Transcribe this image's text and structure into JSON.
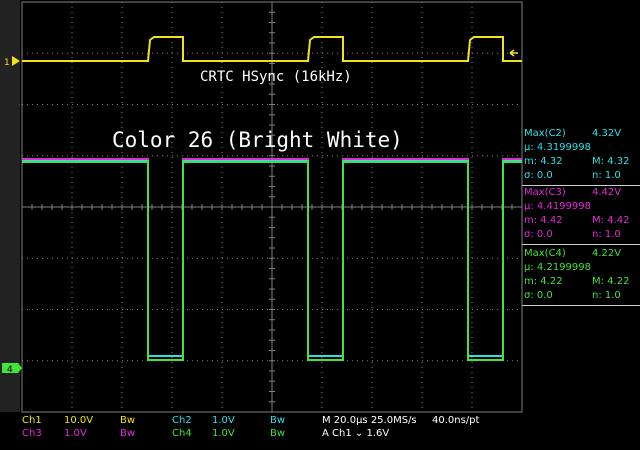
{
  "colors": {
    "ch1": "#f2e21a",
    "ch2": "#2ae0e8",
    "ch3": "#e22ad8",
    "ch4": "#44e23a",
    "grid": "#808080",
    "white": "#ffffff"
  },
  "channels": {
    "ch1_marker": "1",
    "ch4_marker": "4"
  },
  "signal_label": "CRTC HSync (16kHz)",
  "overlay_title": "Color 26 (Bright White)",
  "measurements": [
    {
      "title": "Max(C2)",
      "value": "4.32V",
      "mu": "µ: 4.3199998",
      "m": "m: 4.32",
      "M": "M: 4.32",
      "sigma": "σ: 0.0",
      "n": "n: 1.0",
      "color": "#2ae0e8"
    },
    {
      "title": "Max(C3)",
      "value": "4.42V",
      "mu": "µ: 4.4199998",
      "m": "m: 4.42",
      "M": "M: 4.42",
      "sigma": "σ: 0.0",
      "n": "n: 1.0",
      "color": "#e22ad8"
    },
    {
      "title": "Max(C4)",
      "value": "4.22V",
      "mu": "µ: 4.2199998",
      "m": "m: 4.22",
      "M": "M: 4.22",
      "sigma": "σ: 0.0",
      "n": "n: 1.0",
      "color": "#44e23a"
    }
  ],
  "status": {
    "ch1_label": "Ch1",
    "ch1_scale": "10.0V",
    "ch3_label": "Ch3",
    "ch3_scale": "1.0V",
    "ch2_label": "Ch2",
    "ch2_scale": "1.0V",
    "ch4_label": "Ch4",
    "ch4_scale": "1.0V",
    "bw": "Bw",
    "timebase": "M 20.0µs 25.0MS/s",
    "record": "40.0ns/pt",
    "trigger": "A  Ch1  ⌄  1.6V"
  }
}
